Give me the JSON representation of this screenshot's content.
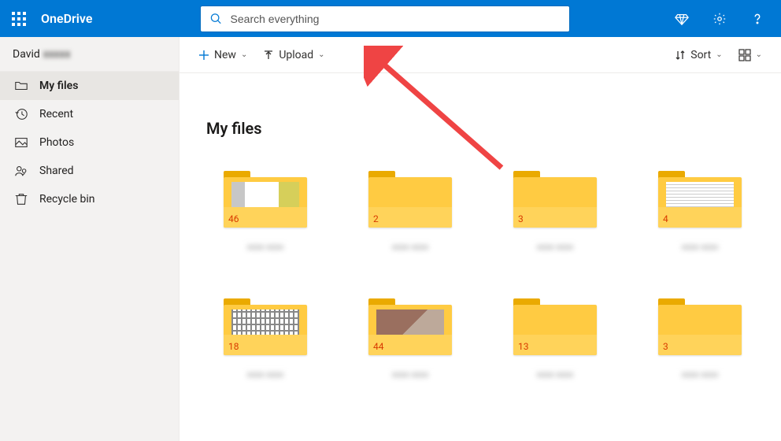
{
  "app": {
    "title": "OneDrive"
  },
  "search": {
    "placeholder": "Search everything"
  },
  "user": {
    "first_name": "David",
    "last_name_obscured": "xxxxx"
  },
  "sidebar": {
    "items": [
      {
        "label": "My files",
        "icon": "folder-icon",
        "active": true
      },
      {
        "label": "Recent",
        "icon": "recent-icon"
      },
      {
        "label": "Photos",
        "icon": "photo-icon"
      },
      {
        "label": "Shared",
        "icon": "shared-icon"
      },
      {
        "label": "Recycle bin",
        "icon": "recycle-icon"
      }
    ]
  },
  "toolbar": {
    "new_label": "New",
    "upload_label": "Upload",
    "sort_label": "Sort"
  },
  "content": {
    "title": "My files"
  },
  "folders": [
    {
      "count": "46",
      "has_preview": true,
      "preview_type": "photo"
    },
    {
      "count": "2",
      "has_preview": false
    },
    {
      "count": "3",
      "has_preview": false
    },
    {
      "count": "4",
      "has_preview": true,
      "preview_type": "document"
    },
    {
      "count": "18",
      "has_preview": true,
      "preview_type": "thumbnails"
    },
    {
      "count": "44",
      "has_preview": true,
      "preview_type": "photo"
    },
    {
      "count": "13",
      "has_preview": false
    },
    {
      "count": "3",
      "has_preview": false
    }
  ]
}
